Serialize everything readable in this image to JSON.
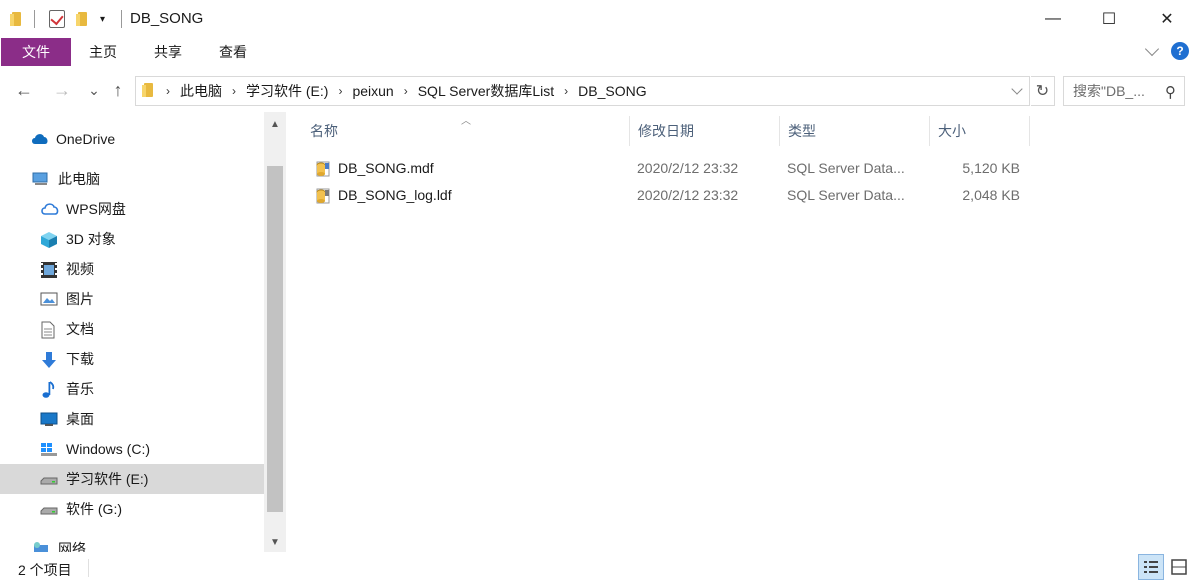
{
  "window": {
    "title": "DB_SONG",
    "minimize": "—",
    "maximize": "☐",
    "close": "✕"
  },
  "ribbon": {
    "tabs": [
      "文件",
      "主页",
      "共享",
      "查看"
    ],
    "help": "?"
  },
  "nav": {
    "back": "←",
    "forward": "→",
    "recent": "⌄",
    "up": "↑"
  },
  "address": {
    "crumbs": [
      "此电脑",
      "学习软件 (E:)",
      "peixun",
      "SQL Server数据库List",
      "DB_SONG"
    ]
  },
  "search": {
    "placeholder": "搜索\"DB_..."
  },
  "sidebar": {
    "items": [
      {
        "label": "OneDrive",
        "icon": "cloud-icon"
      },
      {
        "label": "此电脑",
        "icon": "computer-icon"
      },
      {
        "label": "WPS网盘",
        "icon": "wps-cloud-icon"
      },
      {
        "label": "3D 对象",
        "icon": "cube-3d-icon"
      },
      {
        "label": "视频",
        "icon": "video-icon"
      },
      {
        "label": "图片",
        "icon": "picture-icon"
      },
      {
        "label": "文档",
        "icon": "document-icon"
      },
      {
        "label": "下载",
        "icon": "download-icon"
      },
      {
        "label": "音乐",
        "icon": "music-icon"
      },
      {
        "label": "桌面",
        "icon": "desktop-icon"
      },
      {
        "label": "Windows (C:)",
        "icon": "windows-drive-icon"
      },
      {
        "label": "学习软件 (E:)",
        "icon": "drive-icon",
        "selected": true
      },
      {
        "label": "软件 (G:)",
        "icon": "drive-icon"
      },
      {
        "label": "网络",
        "icon": "network-icon"
      }
    ]
  },
  "columns": {
    "name": "名称",
    "modified": "修改日期",
    "type": "类型",
    "size": "大小"
  },
  "files": [
    {
      "name": "DB_SONG.mdf",
      "modified": "2020/2/12 23:32",
      "type": "SQL Server Data...",
      "size": "5,120 KB"
    },
    {
      "name": "DB_SONG_log.ldf",
      "modified": "2020/2/12 23:32",
      "type": "SQL Server Data...",
      "size": "2,048 KB"
    }
  ],
  "status": {
    "count": "2 个项目"
  },
  "colors": {
    "file_tab": "#8b2d88",
    "selected_nav": "#d9d9d9",
    "header_text": "#4c607a"
  }
}
